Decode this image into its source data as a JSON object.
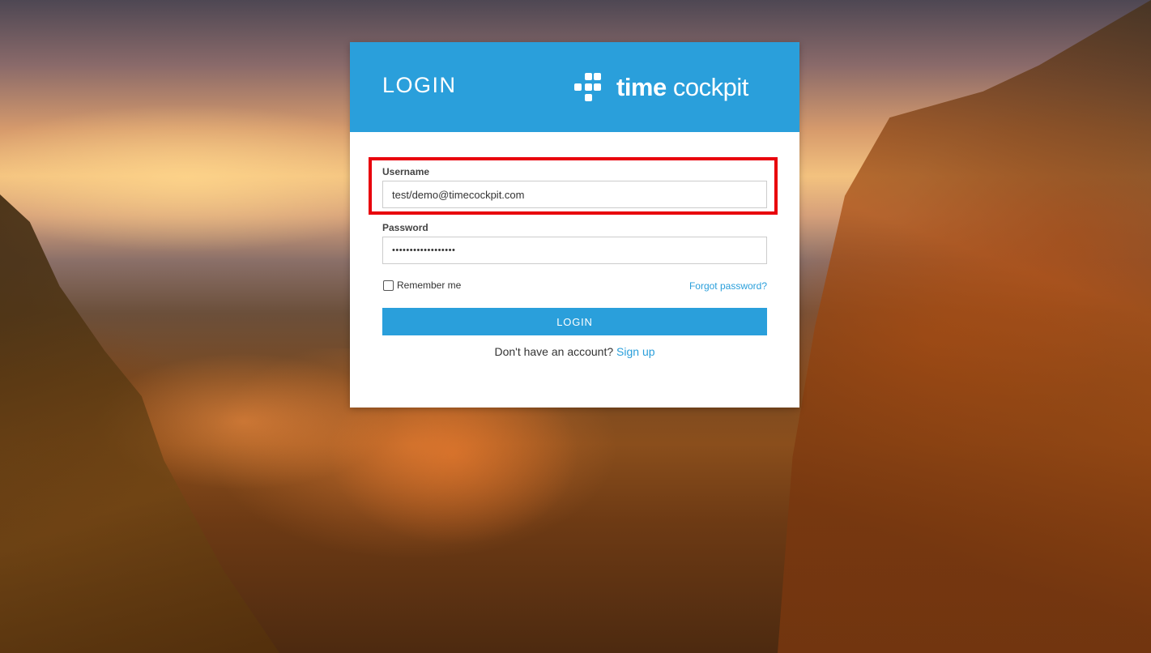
{
  "header": {
    "title": "LOGIN",
    "logo_text_bold": "time",
    "logo_text_rest": " cockpit",
    "logo_icon": "timecockpit-logo-icon"
  },
  "form": {
    "username_label": "Username",
    "username_value": "test/demo@timecockpit.com",
    "password_label": "Password",
    "password_value": "••••••••••••••••••",
    "remember_label": "Remember me",
    "remember_checked": false,
    "forgot_link": "Forgot password?",
    "login_button": "LOGIN",
    "signup_prompt": "Don't have an account? ",
    "signup_link": "Sign up"
  },
  "colors": {
    "accent": "#2a9fdb",
    "highlight": "#e8000c"
  }
}
